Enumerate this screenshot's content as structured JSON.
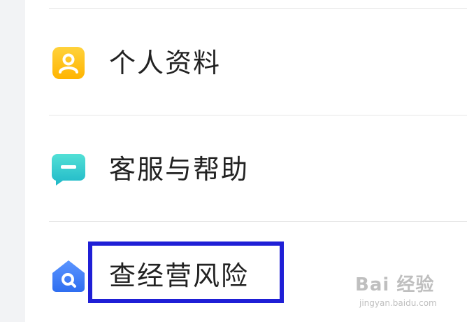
{
  "menu": {
    "items": [
      {
        "label": "个人资料",
        "icon": "user-profile-icon",
        "color": "#ffc21a"
      },
      {
        "label": "客服与帮助",
        "icon": "chat-bubble-icon",
        "color": "#33cccc"
      },
      {
        "label": "查经营风险",
        "icon": "house-search-icon",
        "color": "#3d7cff"
      }
    ]
  },
  "highlight": {
    "color": "#1f1fd6"
  },
  "watermark": {
    "text": "Bai 经验",
    "sub": "jingyan.baidu.com"
  }
}
